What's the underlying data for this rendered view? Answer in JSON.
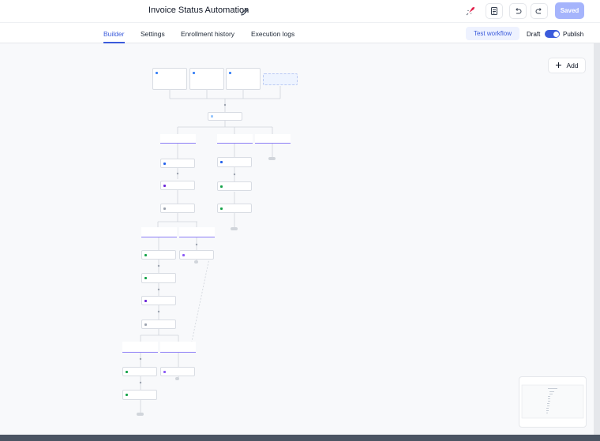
{
  "header": {
    "title": "Invoice Status Automation",
    "saved_label": "Saved"
  },
  "tabs": [
    {
      "label": "Builder",
      "active": true
    },
    {
      "label": "Settings",
      "active": false
    },
    {
      "label": "Enrollment history",
      "active": false
    },
    {
      "label": "Execution logs",
      "active": false
    }
  ],
  "actions": {
    "test_workflow_label": "Test workflow",
    "draft_label": "Draft",
    "publish_label": "Publish",
    "publish_enabled": true
  },
  "canvas": {
    "add_label": "Add"
  },
  "colors": {
    "accent": "#3b5bdb",
    "saved_button": "#a5b4fc",
    "branch_underline": "#8b7cf6",
    "canvas_bg": "#f8f9fb"
  },
  "icons": [
    "pencil-icon",
    "rocket-icon",
    "document-icon",
    "undo-icon",
    "redo-icon",
    "plus-icon"
  ]
}
